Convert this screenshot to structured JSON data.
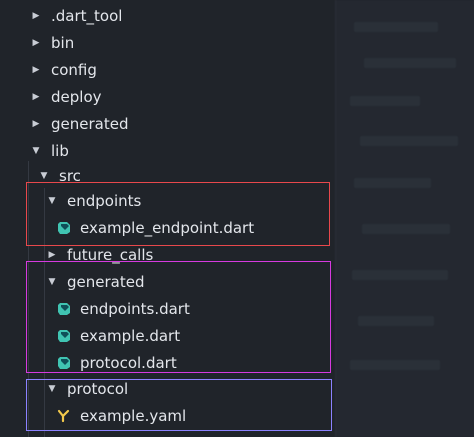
{
  "tree": {
    "items": [
      {
        "label": ".dart_tool"
      },
      {
        "label": "bin"
      },
      {
        "label": "config"
      },
      {
        "label": "deploy"
      },
      {
        "label": "generated"
      },
      {
        "label": "lib"
      },
      {
        "label": "src"
      },
      {
        "label": "endpoints"
      },
      {
        "label": "example_endpoint.dart"
      },
      {
        "label": "future_calls"
      },
      {
        "label": "generated"
      },
      {
        "label": "endpoints.dart"
      },
      {
        "label": "example.dart"
      },
      {
        "label": "protocol.dart"
      },
      {
        "label": "protocol"
      },
      {
        "label": "example.yaml"
      }
    ]
  },
  "colors": {
    "background": "#20242a",
    "text": "#e3e6eb",
    "dart_icon": "#40c4b2",
    "yaml_icon": "#f2c94c",
    "box_endpoints": "#e8484c",
    "box_generated": "#d63adf",
    "box_protocol": "#8c82ff"
  },
  "icons": {
    "collapsed_folder": "chevron-right-icon",
    "expanded_folder": "chevron-down-icon",
    "dart_file": "dart-file-icon",
    "yaml_file": "yaml-file-icon"
  }
}
